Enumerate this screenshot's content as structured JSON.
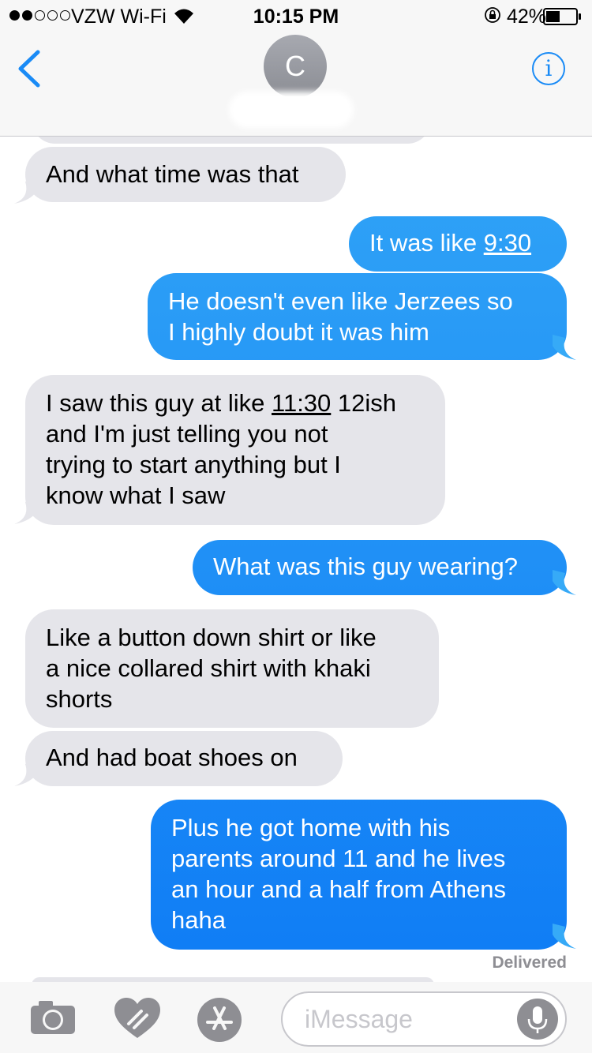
{
  "status": {
    "carrier": "VZW Wi-Fi",
    "time": "10:15 PM",
    "battery": "42%"
  },
  "contact": {
    "initial": "C"
  },
  "messages": [
    {
      "from": "them",
      "text": "And what time was that"
    },
    {
      "from": "me",
      "text": "It was like ",
      "link": "9:30"
    },
    {
      "from": "me",
      "lines": [
        "He doesn't even like Jerzees so",
        "I highly doubt it was him"
      ]
    },
    {
      "from": "them",
      "lines": [
        "I saw this guy at like ",
        "and I'm just telling you not",
        "trying to start anything but I",
        "know what I saw"
      ],
      "link": "11:30",
      "after_link": " 12ish"
    },
    {
      "from": "me",
      "text": "What was this guy wearing?"
    },
    {
      "from": "them",
      "lines": [
        "Like a button down shirt or like",
        "a nice collared shirt with khaki",
        "shorts"
      ]
    },
    {
      "from": "them",
      "text": "And had boat shoes on"
    },
    {
      "from": "me",
      "lines": [
        "Plus he got home with his",
        "parents around 11 and he lives",
        "an hour and a half from Athens",
        "haha"
      ]
    }
  ],
  "delivered": "Delivered",
  "input": {
    "placeholder": "iMessage"
  },
  "colors": {
    "accent": "#1a8bf6",
    "incoming": "#e5e5ea",
    "outgoing_light": "#36aaf7",
    "outgoing_dark": "#0c79f5"
  }
}
